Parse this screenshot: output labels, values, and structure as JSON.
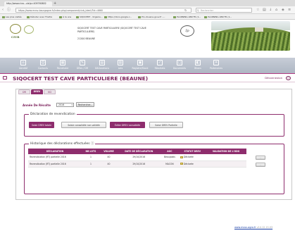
{
  "browser": {
    "tab_title": "http://www.civa...ule/p=409760802",
    "new_tab": "+",
    "url": "https://www.mvsv-bourgogne.fr/index.php/component/civb_ident/?id=4660",
    "search_placeholder": "Rechercher",
    "bookmarks": [
      "Les plus visités",
      "Débuter avec Firefox",
      "À la une",
      "SIQOCERT - Organis...",
      "https://docs.google.c...",
      "Pro-douane.gouv.fr -...",
      "PLANNING ABR FR (1...",
      "PLANNING ABR FR (1..."
    ]
  },
  "header": {
    "civb_logo_text": "CIVB",
    "company_line1": "SIQOCERT TEST CAVE PARTICULIERE (SIQOCERT TEST CAVE",
    "company_line2": "PARTICULIERE)",
    "company_address": "21200 BEAUNE",
    "ip_logo_text": "Ip"
  },
  "menu": {
    "items": [
      {
        "label": "Identité",
        "icon": "home-icon"
      },
      {
        "label": "Contacts",
        "icon": "contacts-icon"
      },
      {
        "label": "Parcellaire",
        "icon": "parcel-icon"
      },
      {
        "label": "DRev / DR",
        "icon": "drev-icon"
      },
      {
        "label": "Déclarations",
        "icon": "declarations-icon"
      },
      {
        "label": "Lots",
        "icon": "lots-icon"
      },
      {
        "label": "Registre/Stock",
        "icon": "register-icon"
      },
      {
        "label": "Résultats",
        "icon": "results-icon"
      },
      {
        "label": "Documents",
        "icon": "documents-icon"
      },
      {
        "label": "Bilans",
        "icon": "bilans-icon"
      },
      {
        "label": "Partenaires",
        "icon": "partners-icon"
      }
    ]
  },
  "title_bar": {
    "title": "SIQOCERT TEST CAVE PARTICULIERE (BEAUNE)",
    "logout_label": "Déconnexion"
  },
  "tabs": [
    {
      "label": "DR",
      "active": false
    },
    {
      "label": "DREV",
      "active": true
    },
    {
      "label": "VCI",
      "active": false
    }
  ],
  "filter": {
    "year_label": "Année De Récolte",
    "year_value": "2016",
    "search_button": "Rechercher..."
  },
  "claim": {
    "legend": "Déclaration de revendication",
    "buttons": [
      {
        "label": "Saisir DREV totale",
        "primary": true
      },
      {
        "label": "Saisie consolidée non validée",
        "primary": false
      },
      {
        "label": "Éditer DREV consolidée",
        "primary": true
      },
      {
        "label": "Saisir DREV Partielle",
        "primary": false
      }
    ]
  },
  "history": {
    "legend": "Historique des déclarations effectuées",
    "columns": [
      "DÉCLARATION",
      "NB LOTS",
      "VOLUME",
      "DATE DE DÉCLARATION",
      "AOC",
      "STATUT DREV",
      "VALIDATION DE L'ODG"
    ],
    "rows": [
      [
        "Revendication (RT) partielle 2016",
        "1",
        "40",
        "29/10/2016",
        "Beaujolais",
        "Déclarée",
        ""
      ],
      [
        "Revendication (RT) partielle 2016",
        "1",
        "40",
        "29/10/2016",
        "MACON",
        "Déclarée",
        ""
      ]
    ],
    "row_action": "···"
  },
  "footer": {
    "link": "www.mvsv-agro.fr",
    "version": " v14.12.15.03"
  }
}
